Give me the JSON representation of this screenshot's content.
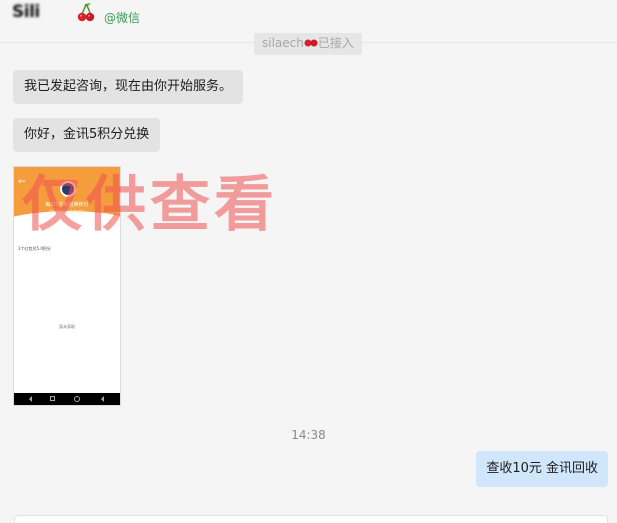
{
  "header": {
    "contact_name": "Sili",
    "source_tag": "@微信"
  },
  "system_notice": {
    "before": "silaech",
    "after": "已接入"
  },
  "messages": [
    {
      "direction": "in",
      "type": "text",
      "text": "我已发起咨询，现在由你开始服务。"
    },
    {
      "direction": "in",
      "type": "text",
      "text": "你好，金讯5积分兑换"
    },
    {
      "direction": "in",
      "type": "image",
      "screenshot": {
        "title": "每日1兑红包换积分",
        "subtitle": "金讯5积分 兑换成功",
        "row": "1个红包兑5.0积分",
        "empty": "暂未获取"
      }
    },
    {
      "direction": "out",
      "type": "text",
      "text": "查收10元  金讯回收"
    }
  ],
  "timestamp": "14:38",
  "watermark": "仅供查看",
  "colors": {
    "incoming_bubble": "#e3e3e3",
    "outgoing_bubble": "#d0e6fb",
    "wechat_green": "#3e9a56",
    "watermark": "#ec5050"
  }
}
